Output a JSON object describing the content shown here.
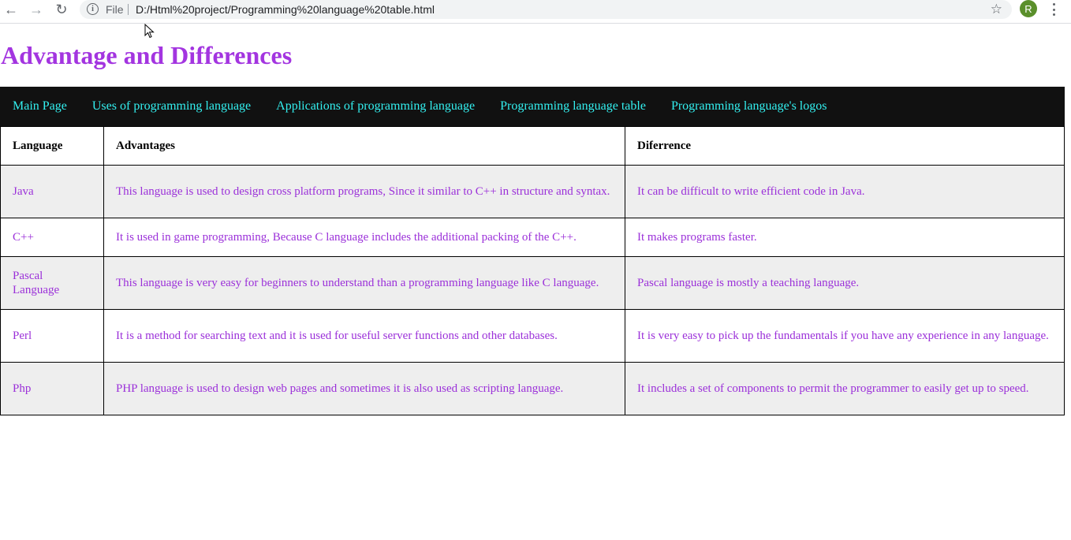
{
  "browser": {
    "scheme": "File",
    "url": "D:/Html%20project/Programming%20language%20table.html",
    "profile_initial": "R"
  },
  "page": {
    "title": "Advantage and Differences",
    "nav": [
      {
        "label": "Main Page"
      },
      {
        "label": "Uses of programming language"
      },
      {
        "label": "Applications of programming language"
      },
      {
        "label": "Programming language table"
      },
      {
        "label": "Programming language's logos"
      }
    ],
    "table": {
      "headers": [
        "Language",
        "Advantages",
        "Diferrence"
      ],
      "rows": [
        {
          "language": "Java",
          "advantages": "This language is used to design cross platform programs, Since it similar to C++ in structure and syntax.",
          "difference": "It can be difficult to write efficient code in Java."
        },
        {
          "language": "C++",
          "advantages": "It is used in game programming, Because C language includes the additional packing of the C++.",
          "difference": "It makes programs faster."
        },
        {
          "language": "Pascal Language",
          "advantages": "This language is very easy for beginners to understand than a programming language like C language.",
          "difference": "Pascal language is mostly a teaching language."
        },
        {
          "language": "Perl",
          "advantages": "It is a method for searching text and it is used for useful server functions and other databases.",
          "difference": "It is very easy to pick up the fundamentals if you have any experience in any language."
        },
        {
          "language": "Php",
          "advantages": "PHP language is used to design web pages and sometimes it is also used as scripting language.",
          "difference": "It includes a set of components to permit the programmer to easily get up to speed."
        }
      ]
    }
  },
  "colors": {
    "title": "#a335e0",
    "nav_bg": "#111111",
    "nav_link": "#33f0f0",
    "cell_text": "#9b30d9",
    "alt_row": "#eeeeee"
  }
}
